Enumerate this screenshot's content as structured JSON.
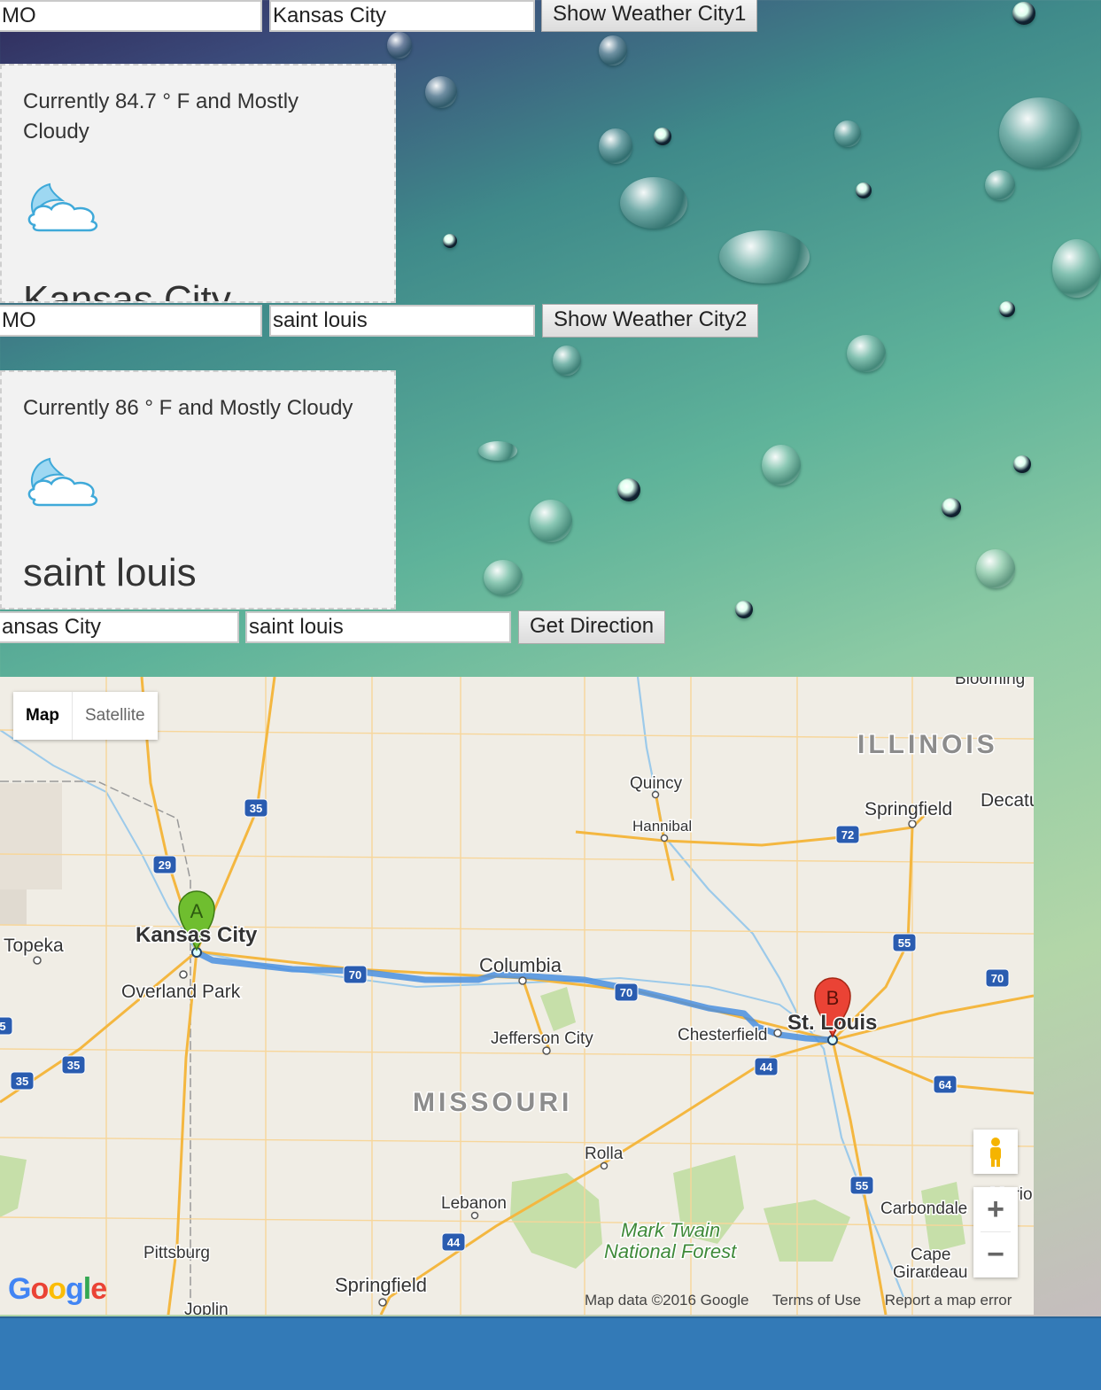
{
  "city1_form": {
    "state_value": "MO",
    "city_value": "Kansas City",
    "button_label": "Show Weather City1"
  },
  "city1_weather": {
    "conditions": "Currently 84.7 ° F and Mostly Cloudy",
    "city_name": "Kansas City",
    "icon": "partly-cloudy-night-icon"
  },
  "city2_form": {
    "state_value": "MO",
    "city_value": "saint louis",
    "button_label": "Show Weather City2"
  },
  "city2_weather": {
    "conditions": "Currently 86 ° F and Mostly Cloudy",
    "city_name": "saint louis",
    "icon": "partly-cloudy-night-icon"
  },
  "direction_form": {
    "origin_value": "ansas City",
    "destination_value": "saint louis",
    "button_label": "Get Direction"
  },
  "map": {
    "map_type": {
      "map": "Map",
      "satellite": "Satellite",
      "selected": "Map"
    },
    "labels": {
      "illinois": "ILLINOIS",
      "missouri": "MISSOURI",
      "quincy": "Quincy",
      "hannibal": "Hannibal",
      "springfield_il": "Springfield",
      "decatur": "Decatu",
      "topeka": "Topeka",
      "kansas_city": "Kansas City",
      "overland_park": "Overland Park",
      "columbia": "Columbia",
      "jefferson_city": "Jefferson City",
      "chesterfield": "Chesterfield",
      "st_louis": "St. Louis",
      "rolla": "Rolla",
      "lebanon": "Lebanon",
      "mark_twain": "Mark Twain",
      "national_forest": "National Forest",
      "pittsburg": "Pittsburg",
      "springfield_mo": "Springfield",
      "joplin": "Joplin",
      "carbondale": "Carbondale",
      "cape": "Cape",
      "girardeau": "Girardeau",
      "bloomington": "Blooming",
      "marion": "Mario"
    },
    "highways": [
      "35",
      "29",
      "70",
      "70",
      "55",
      "72",
      "70",
      "44",
      "64",
      "35",
      "35",
      "55",
      "44",
      "5"
    ],
    "markers": {
      "a": "A",
      "b": "B"
    },
    "google_logo": "Google",
    "footer": {
      "map_data": "Map data ©2016 Google",
      "terms": "Terms of Use",
      "report": "Report a map error"
    },
    "colors": {
      "route": "#4a8fe0",
      "marker_a": "#6fbe2f",
      "marker_b": "#ea4335"
    }
  }
}
